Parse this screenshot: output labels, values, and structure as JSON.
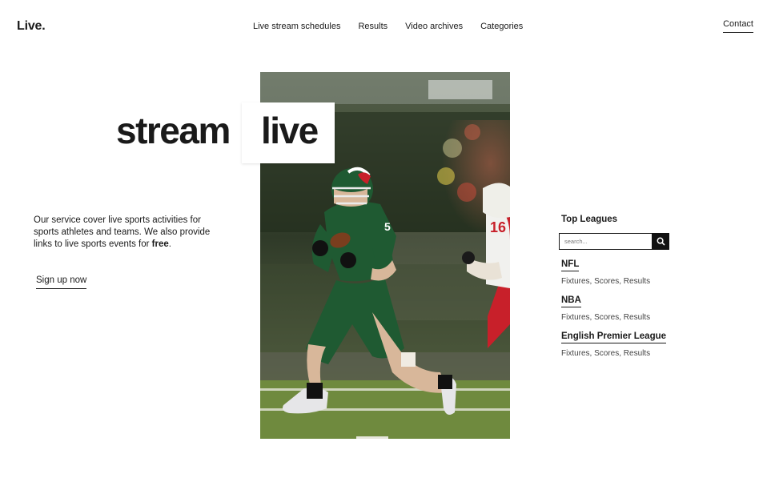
{
  "header": {
    "logo": "Live.",
    "nav": [
      "Live stream schedules",
      "Results",
      "Video archives",
      "Categories"
    ],
    "contact": "Contact"
  },
  "hero": {
    "word1": "stream",
    "word2": "live",
    "image_icon": "american-football-player-photo"
  },
  "intro": {
    "text_before": "Our service cover live sports activities for sports athletes and teams. We also provide links to live sports events for ",
    "text_bold": "free",
    "text_after": ".",
    "signup": "Sign up now"
  },
  "sidebar": {
    "title": "Top Leagues",
    "search_placeholder": "search...",
    "search_icon": "search-icon",
    "leagues": [
      {
        "name": "NFL",
        "sub": "Fixtures, Scores, Results"
      },
      {
        "name": "NBA",
        "sub": "Fixtures, Scores, Results"
      },
      {
        "name": "English Premier League",
        "sub": "Fixtures, Scores, Results"
      }
    ]
  },
  "colors": {
    "text": "#1a1a1a",
    "jersey_green": "#1f5a32",
    "opponent_red": "#c8202a",
    "field_green": "#6f8a3e"
  }
}
